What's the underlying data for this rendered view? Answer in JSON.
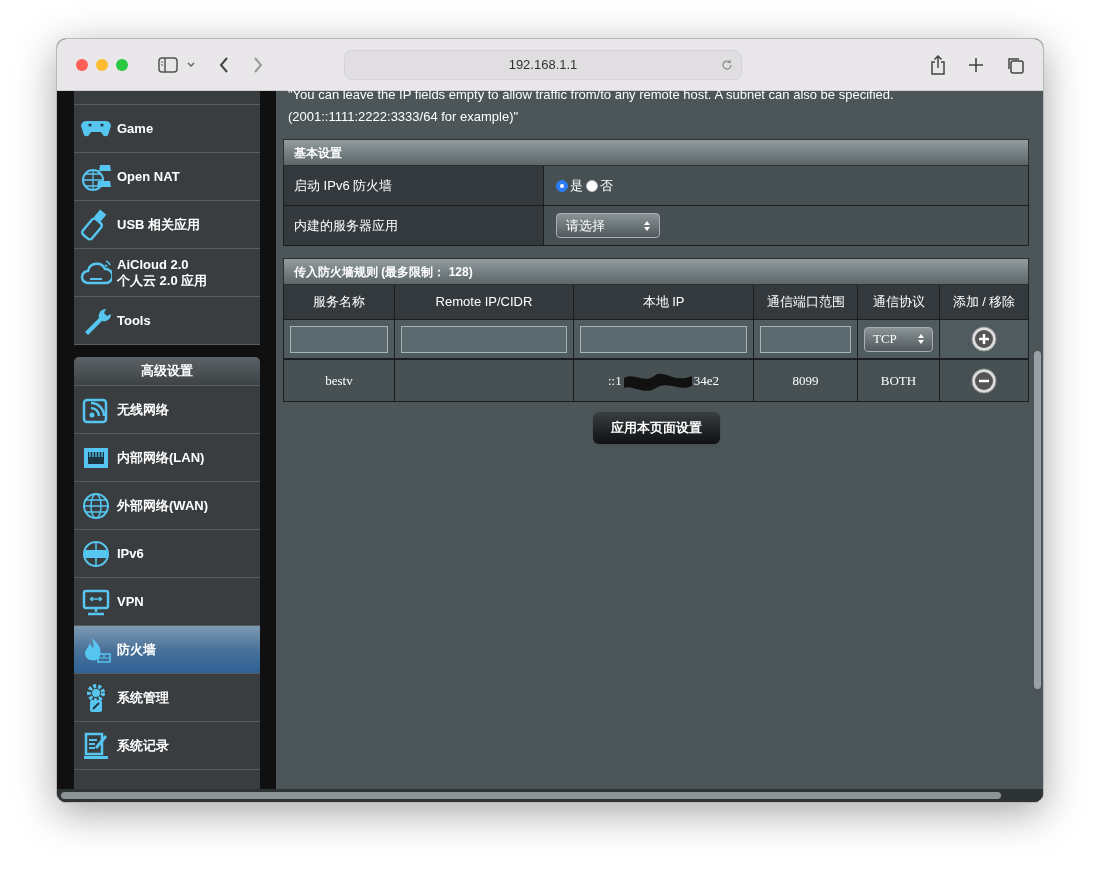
{
  "browser": {
    "address": "192.168.1.1"
  },
  "sidebar": {
    "groups": [
      {
        "items": [
          {
            "label": [
              "Game"
            ],
            "kind": "gamepad",
            "selected": false
          },
          {
            "label": [
              "Open NAT"
            ],
            "kind": "nat",
            "selected": false
          },
          {
            "label": [
              "USB 相关应用"
            ],
            "kind": "usb",
            "selected": false
          },
          {
            "label": [
              "AiCloud 2.0",
              "个人云 2.0 应用"
            ],
            "kind": "cloud",
            "selected": false
          },
          {
            "label": [
              "Tools"
            ],
            "kind": "tools",
            "selected": false
          }
        ]
      },
      {
        "header": "高级设置",
        "items": [
          {
            "label": [
              "无线网络"
            ],
            "kind": "wireless",
            "selected": false
          },
          {
            "label": [
              "内部网络(LAN)"
            ],
            "kind": "lan",
            "selected": false
          },
          {
            "label": [
              "外部网络(WAN)"
            ],
            "kind": "wan",
            "selected": false
          },
          {
            "label": [
              "IPv6"
            ],
            "kind": "ipv6",
            "selected": false
          },
          {
            "label": [
              "VPN"
            ],
            "kind": "vpn",
            "selected": false
          },
          {
            "label": [
              "防火墙"
            ],
            "kind": "firewall",
            "selected": true
          },
          {
            "label": [
              "系统管理"
            ],
            "kind": "admin",
            "selected": false
          },
          {
            "label": [
              "系统记录"
            ],
            "kind": "log",
            "selected": false
          }
        ]
      }
    ]
  },
  "note": [
    "\"You can leave the IP fields empty to allow traffic from/to any remote host. A subnet can also be specified.",
    "(2001::1111:2222:3333/64 for example)\""
  ],
  "basic": {
    "title": "基本设置",
    "rows": [
      {
        "kind": "radio",
        "label": "启动 IPv6 防火墙",
        "options": [
          {
            "label": "是",
            "selected": true
          },
          {
            "label": "否",
            "selected": false
          }
        ]
      },
      {
        "kind": "select",
        "label": "内建的服务器应用",
        "value": "请选择"
      }
    ]
  },
  "rules": {
    "title": "传入防火墙规则 (最多限制： 128)",
    "columns": [
      "服务名称",
      "Remote IP/CIDR",
      "本地 IP",
      "通信端口范围",
      "通信协议",
      "添加 / 移除"
    ],
    "new_protocol": "TCP",
    "rows": [
      {
        "name": "bestv",
        "remote": "",
        "local_ip_start": "::1",
        "local_ip_end": "34e2",
        "port": "8099",
        "protocol": "BOTH"
      }
    ]
  },
  "apply_button": "应用本页面设置"
}
